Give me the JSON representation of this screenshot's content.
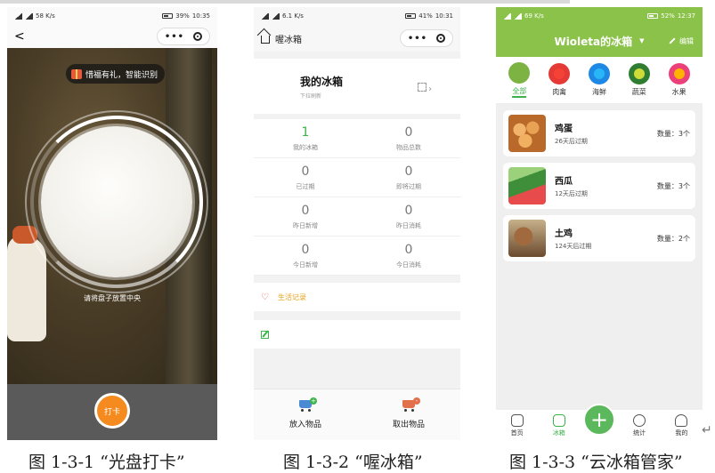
{
  "phone1": {
    "status_speed": "58 K/s",
    "status_battery": "39%",
    "status_time": "10:35",
    "nav": {
      "back": "<",
      "menu": "•••"
    },
    "reward_text": "惜福有礼，智能识别",
    "plate_hint": "请将盘子放置中央",
    "checkin_label": "打卡"
  },
  "phone2": {
    "status_speed": "6.1 K/s",
    "status_battery": "41%",
    "status_time": "10:31",
    "nav_title": "喔冰箱",
    "fridge_title": "我的冰箱",
    "fridge_sub": "下拉刷新",
    "stats": [
      {
        "num": "1",
        "label": "我的冰箱"
      },
      {
        "num": "0",
        "label": "物品总数"
      },
      {
        "num": "0",
        "label": "已过期"
      },
      {
        "num": "0",
        "label": "即将过期"
      },
      {
        "num": "0",
        "label": "昨日新增"
      },
      {
        "num": "0",
        "label": "昨日消耗"
      },
      {
        "num": "0",
        "label": "今日新增"
      },
      {
        "num": "0",
        "label": "今日消耗"
      }
    ],
    "life_record": "生活记录",
    "put_in": "放入物品",
    "take_out": "取出物品"
  },
  "phone3": {
    "status_speed": "69 K/s",
    "status_battery": "52%",
    "status_time": "12:37",
    "header_title": "Wioleta的冰箱",
    "edit_label": "编辑",
    "categories": [
      {
        "label": "全部",
        "color": "#7cb342",
        "inner": "#7cb342"
      },
      {
        "label": "肉禽",
        "color": "#e53935",
        "inner": "#f44336"
      },
      {
        "label": "海鲜",
        "color": "#1e88e5",
        "inner": "#29b6f6"
      },
      {
        "label": "蔬菜",
        "color": "#2e7d32",
        "inner": "#cddc39"
      },
      {
        "label": "水果",
        "color": "#ec407a",
        "inner": "#ffb300"
      }
    ],
    "items": [
      {
        "name": "鸡蛋",
        "expiry": "26天后过期",
        "qty": "数量：3个",
        "thumb": "#d98a3c"
      },
      {
        "name": "西瓜",
        "expiry": "12天后过期",
        "qty": "数量：3个",
        "thumb": "#3f8f3a"
      },
      {
        "name": "土鸡",
        "expiry": "124天后过期",
        "qty": "数量：2个",
        "thumb": "#8a5a3a"
      }
    ],
    "tabs": [
      {
        "label": "首页"
      },
      {
        "label": "冰箱"
      },
      {
        "label": "统计"
      },
      {
        "label": "我的"
      }
    ],
    "fab": "+"
  },
  "captions": {
    "c1": "图 1-3-1 “光盘打卡”",
    "c2": "图 1-3-2 “喔冰箱”",
    "c3": "图 1-3-3 “云冰箱管家”"
  },
  "return_mark": "↵"
}
